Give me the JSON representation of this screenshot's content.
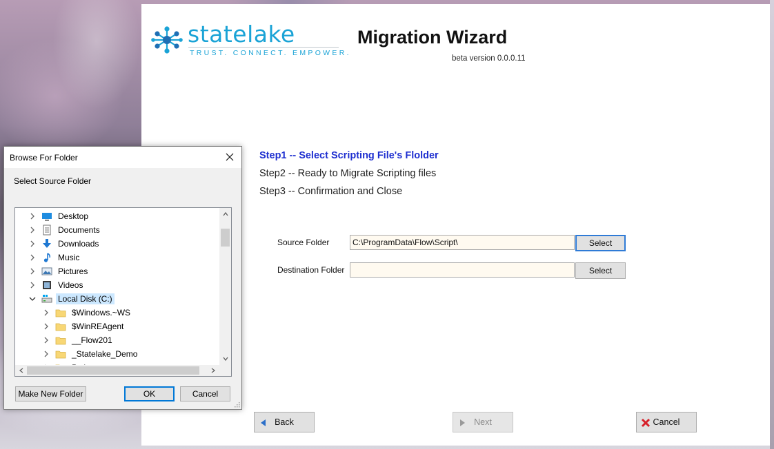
{
  "wizard": {
    "logo": {
      "name": "statelake",
      "tagline": "TRUST. CONNECT. EMPOWER."
    },
    "title": "Migration Wizard",
    "version": "beta version 0.0.0.11",
    "steps": [
      {
        "label": "Step1 -- Select Scripting File's Flolder",
        "active": true
      },
      {
        "label": "Step2 -- Ready to Migrate Scripting files",
        "active": false
      },
      {
        "label": "Step3 -- Confirmation and Close",
        "active": false
      }
    ],
    "source": {
      "label": "Source Folder",
      "value": "C:\\ProgramData\\Flow\\Script\\",
      "button": "Select"
    },
    "destination": {
      "label": "Destination Folder",
      "value": "",
      "button": "Select"
    },
    "nav": {
      "back": "Back",
      "next": "Next",
      "cancel": "Cancel"
    }
  },
  "dialog": {
    "title": "Browse For Folder",
    "prompt": "Select Source Folder",
    "tree": [
      {
        "label": "Desktop",
        "icon": "desktop-icon",
        "level": 0,
        "expanded": false
      },
      {
        "label": "Documents",
        "icon": "documents-icon",
        "level": 0,
        "expanded": false
      },
      {
        "label": "Downloads",
        "icon": "downloads-icon",
        "level": 0,
        "expanded": false
      },
      {
        "label": "Music",
        "icon": "music-icon",
        "level": 0,
        "expanded": false
      },
      {
        "label": "Pictures",
        "icon": "pictures-icon",
        "level": 0,
        "expanded": false
      },
      {
        "label": "Videos",
        "icon": "videos-icon",
        "level": 0,
        "expanded": false
      },
      {
        "label": "Local Disk (C:)",
        "icon": "drive-icon",
        "level": 0,
        "expanded": true,
        "selected": true
      },
      {
        "label": "$Windows.~WS",
        "icon": "folder-icon",
        "level": 1,
        "expanded": false
      },
      {
        "label": "$WinREAgent",
        "icon": "folder-icon",
        "level": 1,
        "expanded": false
      },
      {
        "label": "__Flow201",
        "icon": "folder-icon",
        "level": 1,
        "expanded": false
      },
      {
        "label": "_Statelake_Demo",
        "icon": "folder-icon",
        "level": 1,
        "expanded": false
      },
      {
        "label": "Python",
        "icon": "folder-icon",
        "level": 1,
        "expanded": false
      }
    ],
    "buttons": {
      "make_new_folder": "Make New Folder",
      "ok": "OK",
      "cancel": "Cancel"
    }
  },
  "colors": {
    "brand": "#1aa3d6",
    "active_step": "#1e2fd0",
    "field_bg": "#fffaf0",
    "selection": "#cce8ff",
    "focus": "#2f7bd6"
  }
}
